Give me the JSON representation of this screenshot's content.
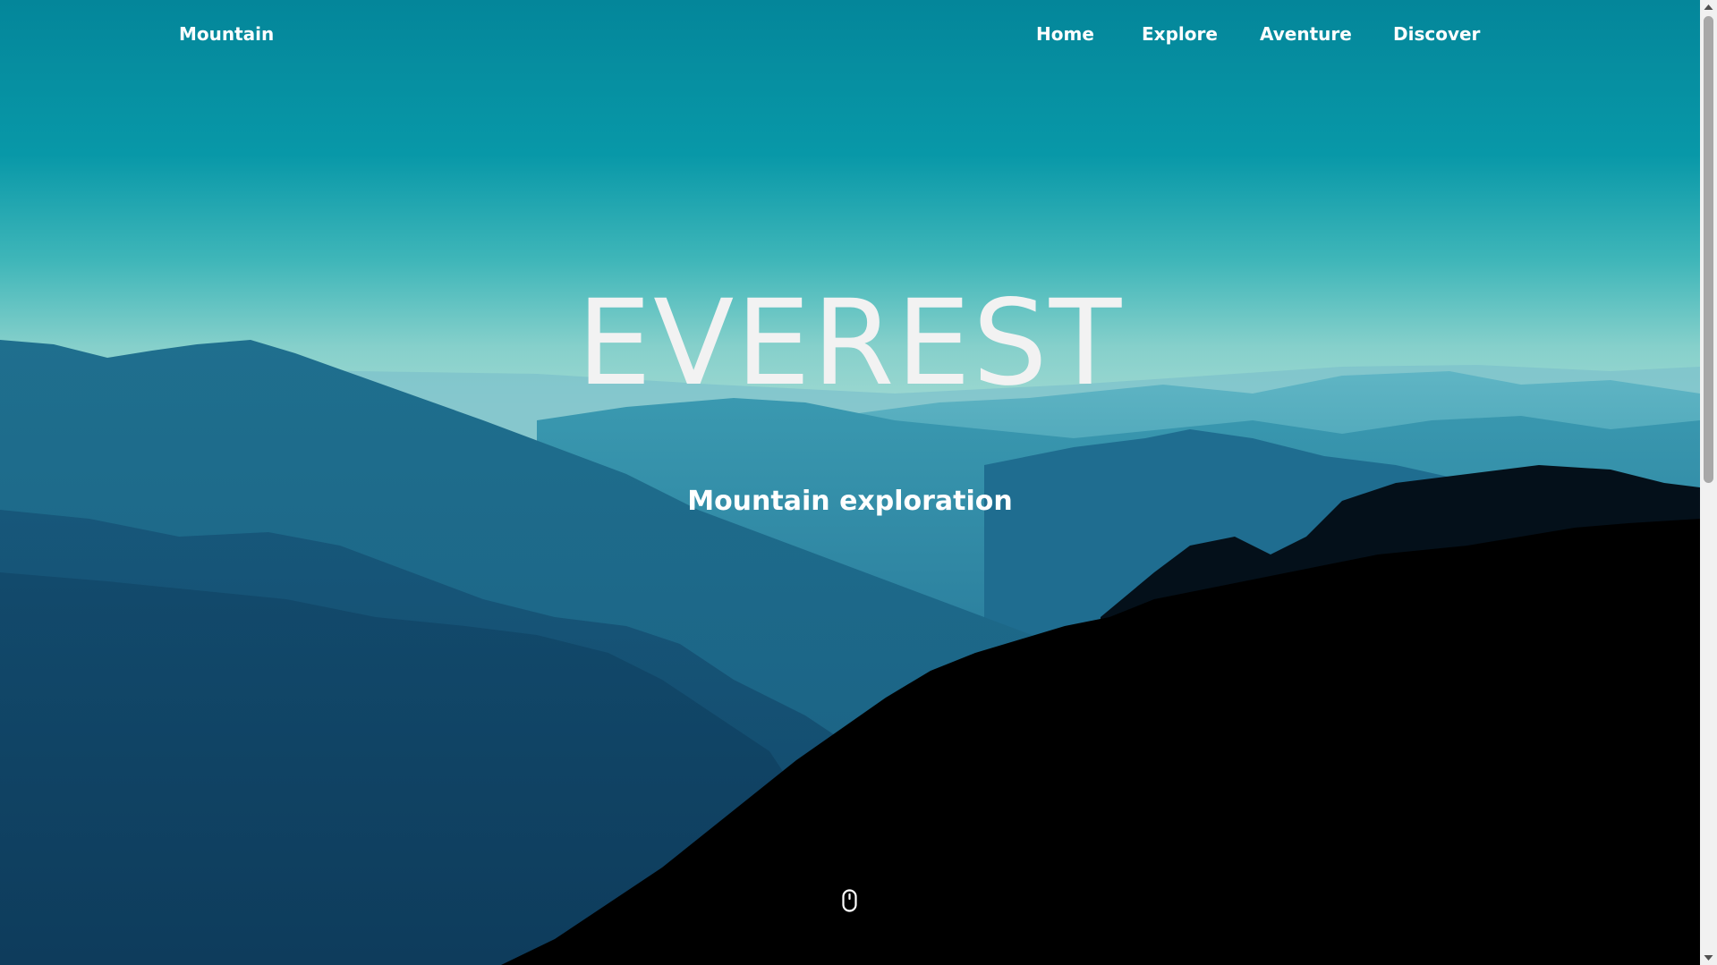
{
  "navbar": {
    "brand": "Mountain",
    "links": [
      "Home",
      "Explore",
      "Aventure",
      "Discover"
    ]
  },
  "hero": {
    "title": "EVEREST",
    "subtitle": "Mountain exploration",
    "scroll_icon": "mouse-icon"
  },
  "colors": {
    "sky_top": "#0590a0",
    "sky_bottom": "#8dd3d0",
    "text": "#ffffff",
    "title_text": "#f2f2f2",
    "foreground_silhouette": "#000000"
  }
}
